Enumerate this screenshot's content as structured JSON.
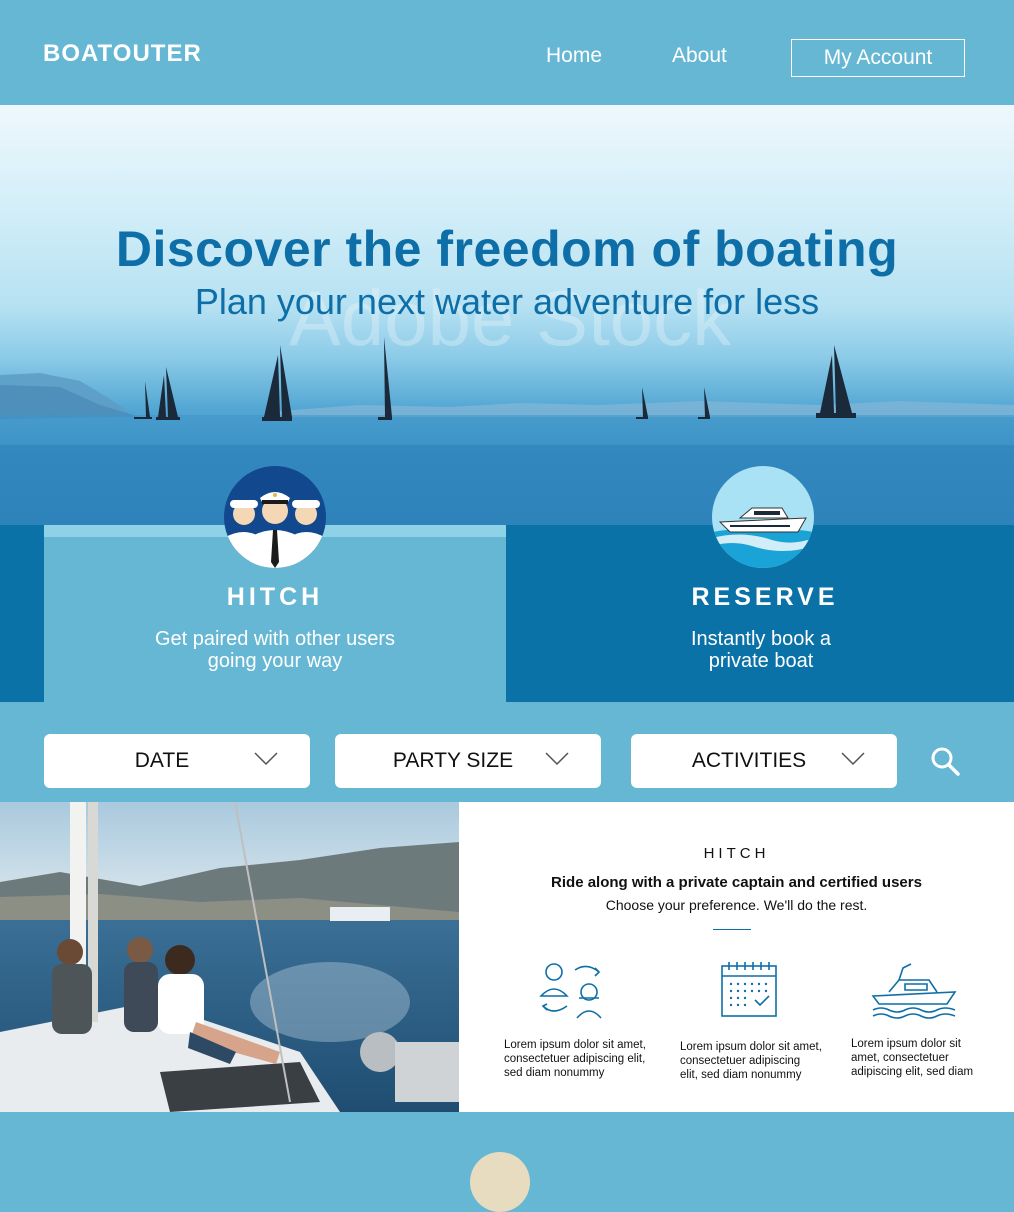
{
  "header": {
    "logo": "BOATOUTER",
    "nav": {
      "home": "Home",
      "about": "About",
      "account": "My Account"
    }
  },
  "hero": {
    "title": "Discover the freedom of boating",
    "subtitle": "Plan your next water adventure for less",
    "watermark": "Adobe Stock"
  },
  "cards": {
    "hitch": {
      "title": "HITCH",
      "desc_line1": "Get paired with other users",
      "desc_line2": "going your way"
    },
    "reserve": {
      "title": "RESERVE",
      "desc_line1": "Instantly book a",
      "desc_line2": "private boat"
    }
  },
  "search": {
    "date": "DATE",
    "party_size": "PARTY SIZE",
    "activities": "ACTIVITIES"
  },
  "info": {
    "kicker": "HITCH",
    "title": "Ride along with a private captain and certified users",
    "subtitle": "Choose your preference. We'll do the rest.",
    "features": [
      {
        "icon": "swap-users-icon",
        "l1": "Lorem ipsum dolor sit amet,",
        "l2": "consectetuer adipiscing elit,",
        "l3": "sed diam nonummy"
      },
      {
        "icon": "calendar-icon",
        "l1": "Lorem ipsum dolor sit amet,",
        "l2": "consectetuer adipiscing",
        "l3": "elit, sed diam nonummy"
      },
      {
        "icon": "boat-icon",
        "l1": "Lorem ipsum dolor sit",
        "l2": "amet, consectetuer",
        "l3": "adipiscing elit, sed diam"
      }
    ]
  },
  "colors": {
    "light_blue": "#66b7d3",
    "dark_blue": "#0b72a8",
    "title_blue": "#0e6fa8"
  }
}
